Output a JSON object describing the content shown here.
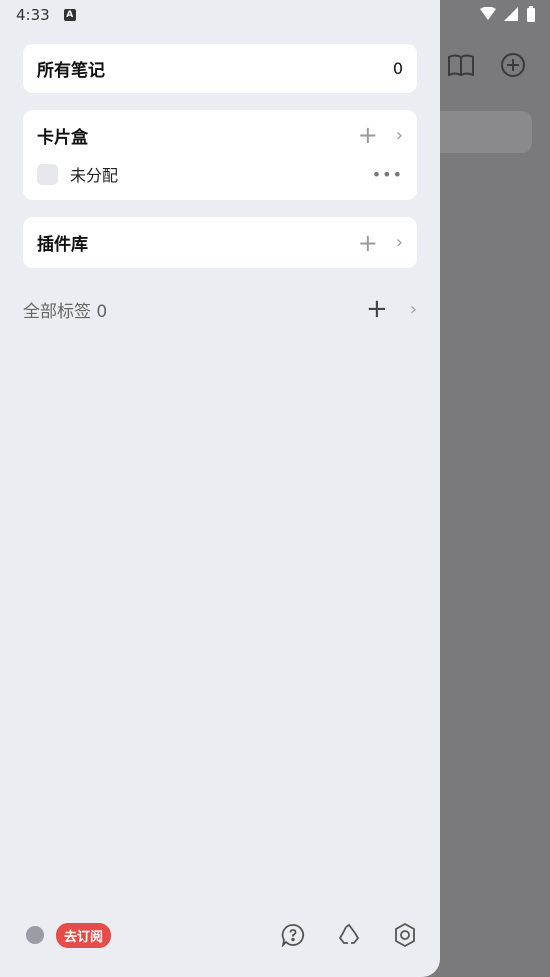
{
  "status_bar": {
    "time": "4:33",
    "badge": "A"
  },
  "all_notes": {
    "label": "所有笔记",
    "count": "0"
  },
  "card_box": {
    "title": "卡片盒",
    "items": [
      {
        "label": "未分配",
        "more": "•••"
      }
    ]
  },
  "plugins": {
    "title": "插件库"
  },
  "tags": {
    "label": "全部标签",
    "count": "0"
  },
  "icons": {
    "plus": "+",
    "chevron": "›"
  },
  "bottom": {
    "subscribe_label": "去订阅"
  }
}
